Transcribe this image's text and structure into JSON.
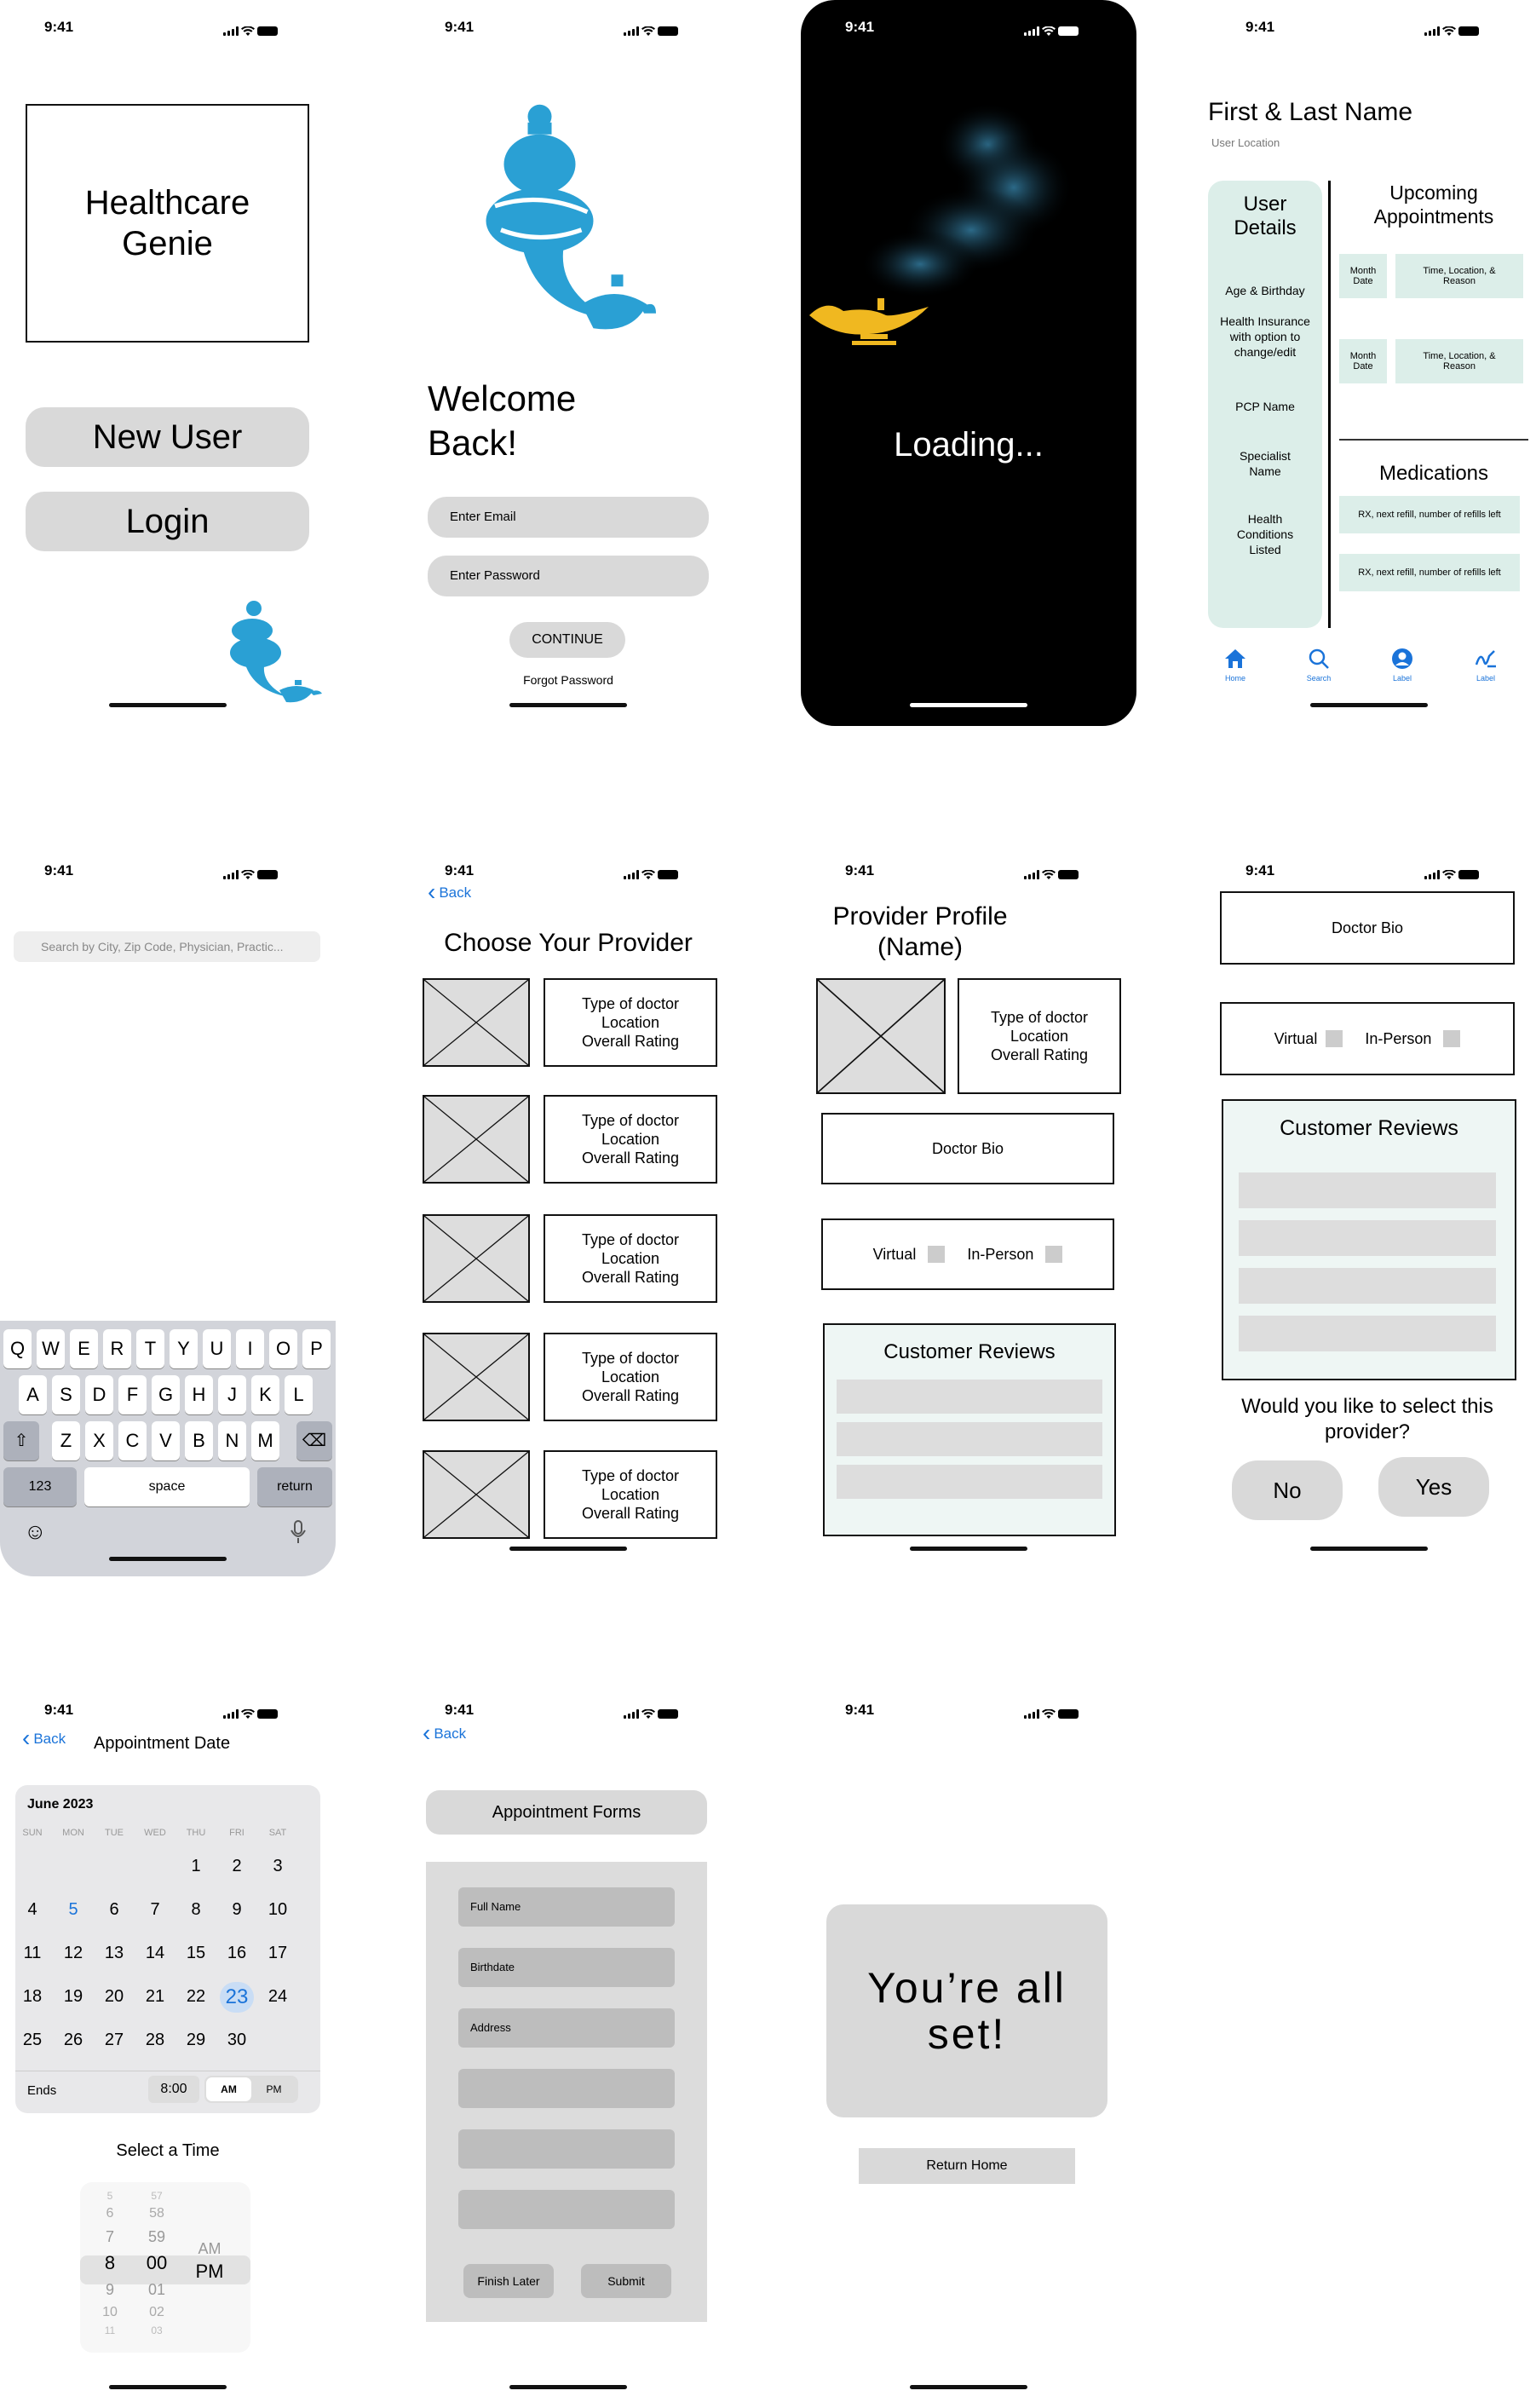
{
  "status_time": "9:41",
  "colors": {
    "genie_blue": "#2aa0d4",
    "ios_blue": "#1a73d9",
    "mint": "#dceee9",
    "grey": "#d9d9d9"
  },
  "s1": {
    "title": "Healthcare Genie",
    "new_user": "New User",
    "login": "Login"
  },
  "s2": {
    "welcome": "Welcome Back!",
    "email_placeholder": "Enter Email",
    "password_placeholder": "Enter Password",
    "continue": "CONTINUE",
    "forgot": "Forgot Password"
  },
  "s3": {
    "loading": "Loading..."
  },
  "s4": {
    "name": "First & Last Name",
    "location": "User Location",
    "user_details": "User Details",
    "details": [
      "Age & Birthday",
      "Health Insurance with option to change/edit",
      "PCP Name",
      "Specialist Name",
      "Health Conditions Listed"
    ],
    "upcoming": "Upcoming Appointments",
    "appointments": [
      {
        "date": "Month Date",
        "info": "Time, Location, & Reason"
      },
      {
        "date": "Month Date",
        "info": "Time, Location, & Reason"
      }
    ],
    "medications": "Medications",
    "rx": [
      "RX, next refill, number of refills left",
      "RX, next refill, number of refills left"
    ],
    "tabs": [
      "Home",
      "Search",
      "Label",
      "Label"
    ]
  },
  "s5": {
    "search_placeholder": "Search by City, Zip Code, Physician, Practic...",
    "row1": [
      "Q",
      "W",
      "E",
      "R",
      "T",
      "Y",
      "U",
      "I",
      "O",
      "P"
    ],
    "row2": [
      "A",
      "S",
      "D",
      "F",
      "G",
      "H",
      "J",
      "K",
      "L"
    ],
    "row3": [
      "Z",
      "X",
      "C",
      "V",
      "B",
      "N",
      "M"
    ],
    "num": "123",
    "space": "space",
    "return": "return"
  },
  "s6": {
    "back": "Back",
    "title": "Choose Your Provider",
    "providers": [
      {
        "line1": "Type of doctor",
        "line2": "Location",
        "line3": "Overall Rating"
      },
      {
        "line1": "Type of doctor",
        "line2": "Location",
        "line3": "Overall Rating"
      },
      {
        "line1": "Type of doctor",
        "line2": "Location",
        "line3": "Overall Rating"
      },
      {
        "line1": "Type of doctor",
        "line2": "Location",
        "line3": "Overall Rating"
      },
      {
        "line1": "Type of doctor",
        "line2": "Location",
        "line3": "Overall Rating"
      }
    ]
  },
  "s7": {
    "title": "Provider Profile (Name)",
    "line1": "Type of doctor",
    "line2": "Location",
    "line3": "Overall Rating",
    "bio": "Doctor Bio",
    "virtual": "Virtual",
    "in_person": "In-Person",
    "reviews": "Customer Reviews"
  },
  "s8": {
    "bio": "Doctor Bio",
    "virtual": "Virtual",
    "in_person": "In-Person",
    "reviews": "Customer Reviews",
    "question": "Would you like to select this provider?",
    "no": "No",
    "yes": "Yes"
  },
  "s9": {
    "back": "Back",
    "title": "Appointment Date",
    "month": "June 2023",
    "weekdays": [
      "SUN",
      "MON",
      "TUE",
      "WED",
      "THU",
      "FRI",
      "SAT"
    ],
    "days": [
      "1",
      "2",
      "3",
      "4",
      "5",
      "6",
      "7",
      "8",
      "9",
      "10",
      "11",
      "12",
      "13",
      "14",
      "15",
      "16",
      "17",
      "18",
      "19",
      "20",
      "21",
      "22",
      "23",
      "24",
      "25",
      "26",
      "27",
      "28",
      "29",
      "30"
    ],
    "ends": "Ends",
    "time": "8:00",
    "am": "AM",
    "pm": "PM",
    "select_time": "Select a Time",
    "picker_hours": [
      "5",
      "6",
      "7",
      "8",
      "9",
      "10",
      "11"
    ],
    "picker_mins": [
      "57",
      "58",
      "59",
      "00",
      "01",
      "02",
      "03"
    ],
    "picker_ampm": [
      "AM",
      "PM"
    ]
  },
  "s10": {
    "back": "Back",
    "title": "Appointment Forms",
    "fields": [
      "Full Name",
      "Birthdate",
      "Address",
      "",
      "",
      ""
    ],
    "finish_later": "Finish Later",
    "submit": "Submit"
  },
  "s11": {
    "message": "You’re all set!",
    "return_home": "Return Home"
  }
}
